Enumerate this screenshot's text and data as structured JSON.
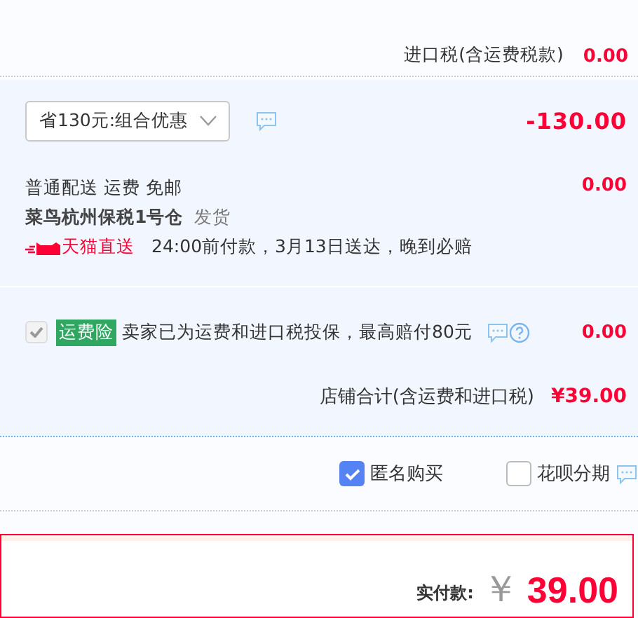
{
  "import_tax": {
    "label": "进口税(含运费税款)",
    "amount": "0.00"
  },
  "promotion": {
    "dropdown_value": "省130元:组合优惠",
    "amount": "-130.00"
  },
  "shipping": {
    "method": "普通配送 运费 免邮",
    "warehouse": "菜鸟杭州保税1号仓",
    "dispatch": "发货",
    "badge": "天猫直送",
    "promise": "24:00前付款，3月13日送达，晚到必赔",
    "amount": "0.00"
  },
  "insurance": {
    "checked": true,
    "disabled": true,
    "tag": "运费险",
    "text": "卖家已为运费和进口税投保，最高赔付80元",
    "amount": "0.00"
  },
  "store_total": {
    "label": "店铺合计(含运费和进口税)",
    "amount": "¥39.00"
  },
  "options": [
    {
      "label": "匿名购买",
      "checked": true,
      "has_info": false
    },
    {
      "label": "花呗分期",
      "checked": false,
      "has_info": true
    }
  ],
  "payment": {
    "label": "实付款:",
    "currency": "￥",
    "amount": "39.00"
  }
}
